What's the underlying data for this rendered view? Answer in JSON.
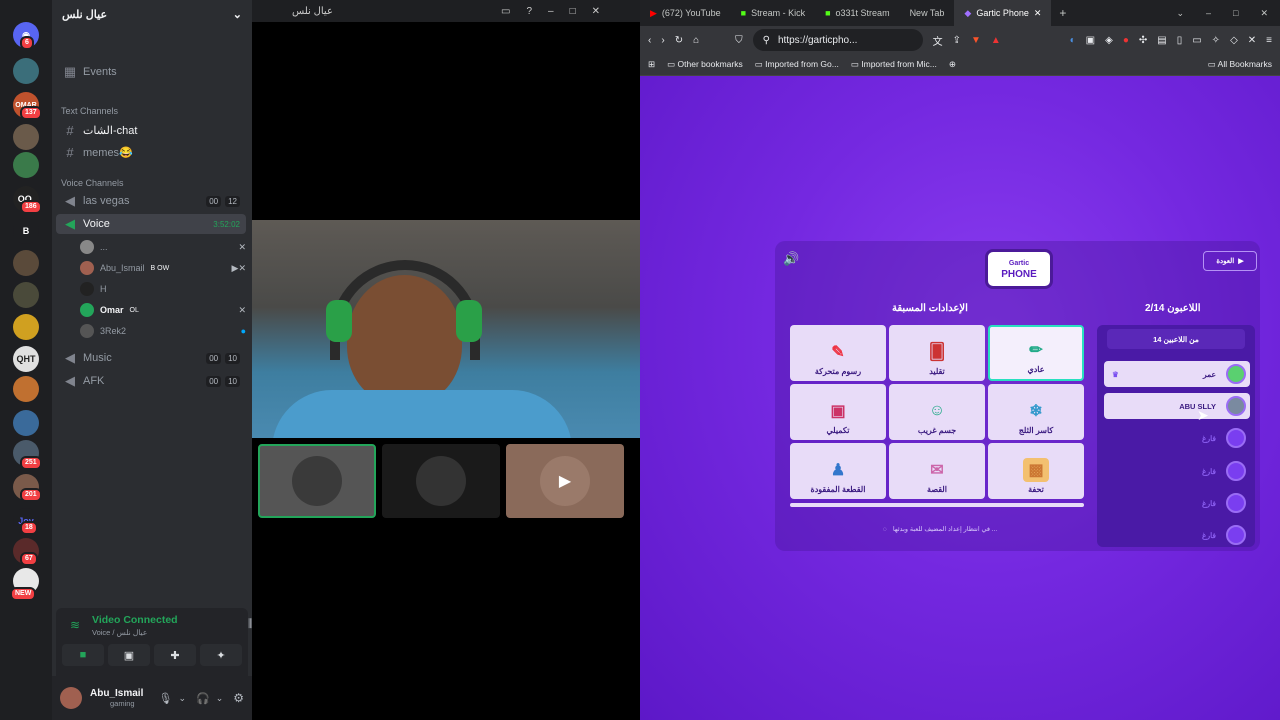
{
  "discord": {
    "server_name": "عيال نلس",
    "events_label": "Events",
    "text_category": "Text Channels",
    "voice_category": "Voice Channels",
    "text_channels": [
      "الشات-chat",
      "memes😂"
    ],
    "voice_channels": [
      {
        "name": "las vegas",
        "a": "00",
        "b": "12"
      },
      {
        "name": "Voice",
        "time": "3:52:02"
      },
      {
        "name": "Music",
        "a": "00",
        "b": "10"
      },
      {
        "name": "AFK",
        "a": "00",
        "b": "10"
      }
    ],
    "voice_users": [
      "...",
      "Abu_Ismail",
      "H",
      "Omar",
      "3Rek2"
    ],
    "user_tags": {
      "abu": "B OW",
      "omar": "OL"
    },
    "server_badges": [
      {
        "label": "6"
      },
      {
        "label": "137"
      },
      {
        "label": "186"
      },
      {
        "label": "251"
      },
      {
        "label": "201"
      },
      {
        "label": "18"
      },
      {
        "label": "67"
      },
      {
        "label": "NEW"
      }
    ],
    "rail_texts": [
      "OMAR",
      "OO.",
      "B",
      "QHT",
      "Joy"
    ],
    "video_connected": "Video Connected",
    "video_sub": "Voice  /  عيال نلس",
    "username": "Abu_Ismail",
    "user_status": "gaming"
  },
  "stage": {
    "title": "عيال نلس"
  },
  "browser": {
    "tabs": [
      "(672) YouTube",
      "Stream - Kick",
      "o331t Stream",
      "New Tab",
      "Gartic Phone"
    ],
    "url": "https://garticpho...",
    "bookmarks": [
      "Other bookmarks",
      "Imported from Go...",
      "Imported from Mic...",
      "All Bookmarks"
    ],
    "new_tab_symbol": "+"
  },
  "game": {
    "logo_top": "Gartic",
    "logo_bottom": "PHONE",
    "back_button": "العودة",
    "presets_title": "الإعدادات المسبقة",
    "players_title": "اللاعبون 2/14",
    "players_header": "14 من اللاعبين",
    "modes": [
      "رسوم متحركة",
      "تقليد",
      "عادي",
      "تكميلي",
      "جسم غريب",
      "كاسر الثلج",
      "القطعة المفقودة",
      "القصة",
      "تحفة"
    ],
    "players": [
      "عمر",
      "ABU SLLY",
      "فارغ",
      "فارغ",
      "فارغ",
      "فارغ"
    ],
    "waiting_text": "في انتظار إعداد المضيف للعبة وبدئها ..."
  },
  "colors": {
    "discord_green": "#23a55a",
    "game_purple": "#7428e0",
    "selected_border": "#29e0c0"
  }
}
